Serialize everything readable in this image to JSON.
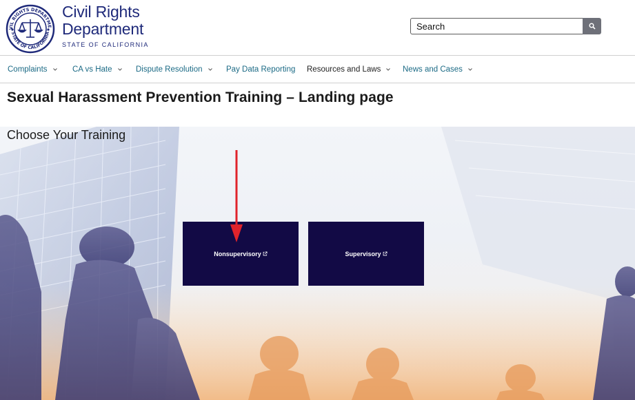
{
  "header": {
    "seal_top_text": "CIVIL RIGHTS DEPARTMENT",
    "seal_bottom_text": "STATE OF CALIFORNIA",
    "brand_line1": "Civil Rights",
    "brand_line2": "Department",
    "brand_sub": "STATE OF CALIFORNIA",
    "search_placeholder": "Search"
  },
  "nav": {
    "items": [
      {
        "label": "Complaints",
        "dropdown": true
      },
      {
        "label": "CA vs Hate",
        "dropdown": true
      },
      {
        "label": "Dispute Resolution",
        "dropdown": true
      },
      {
        "label": "Pay Data Reporting",
        "dropdown": false
      },
      {
        "label": "Resources and Laws",
        "dropdown": true
      },
      {
        "label": "News and Cases",
        "dropdown": true
      }
    ]
  },
  "main": {
    "title": "Sexual Harassment Prevention Training – Landing page",
    "subtitle": "Choose Your Training",
    "tiles": [
      {
        "label": "Nonsupervisory",
        "icon": "external-link-icon"
      },
      {
        "label": "Supervisory",
        "icon": "external-link-icon"
      }
    ]
  },
  "colors": {
    "brand": "#1f2a7a",
    "nav_link": "#1b6a85",
    "tile_bg": "#120a45",
    "arrow": "#e0232b"
  }
}
